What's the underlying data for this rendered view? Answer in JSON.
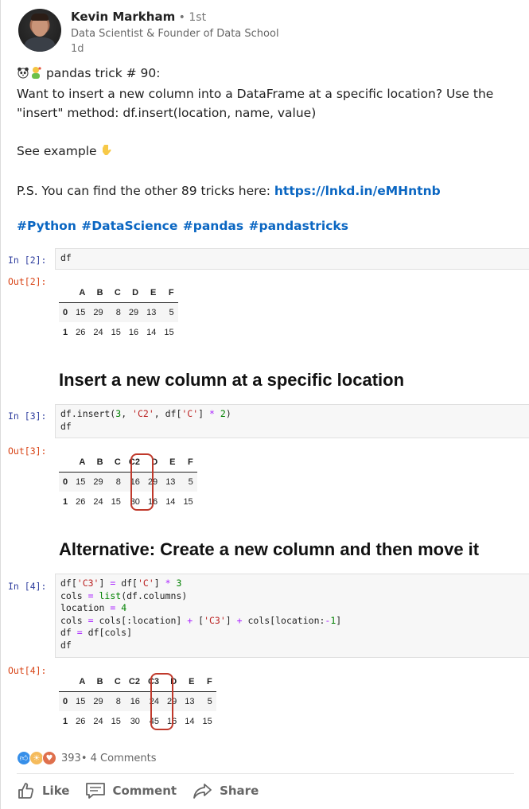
{
  "author": {
    "name": "Kevin Markham",
    "degree": " • 1st",
    "headline": "Data Scientist & Founder of Data School",
    "time": "1d"
  },
  "post": {
    "line1": "pandas trick # 90:",
    "line2": "Want to insert a new column into a DataFrame at a specific location? Use the",
    "line3": "\"insert\" method: df.insert(location, name, value)",
    "see_example": "See example",
    "ps_text": "P.S. You can find the other 89 tricks here: ",
    "ps_link": "https://lnkd.in/eMHntnb",
    "hashtags": "#Python #DataScience #pandas #pandastricks"
  },
  "notebook": {
    "in2": "In [2]:",
    "in2_code": "df",
    "out2": "Out[2]:",
    "in3": "In [3]:",
    "out3": "Out[3]:",
    "in4": "In [4]:",
    "out4": "Out[4]:",
    "title1": "Insert a new column at a specific location",
    "title2": "Alternative: Create a new column and then move it",
    "table1": {
      "columns": [
        "",
        "A",
        "B",
        "C",
        "D",
        "E",
        "F"
      ],
      "rows": [
        [
          "0",
          "15",
          "29",
          "8",
          "29",
          "13",
          "5"
        ],
        [
          "1",
          "26",
          "24",
          "15",
          "16",
          "14",
          "15"
        ]
      ]
    },
    "table2": {
      "columns": [
        "",
        "A",
        "B",
        "C",
        "C2",
        "D",
        "E",
        "F"
      ],
      "rows": [
        [
          "0",
          "15",
          "29",
          "8",
          "16",
          "29",
          "13",
          "5"
        ],
        [
          "1",
          "26",
          "24",
          "15",
          "30",
          "16",
          "14",
          "15"
        ]
      ]
    },
    "table3": {
      "columns": [
        "",
        "A",
        "B",
        "C",
        "C2",
        "C3",
        "D",
        "E",
        "F"
      ],
      "rows": [
        [
          "0",
          "15",
          "29",
          "8",
          "16",
          "24",
          "29",
          "13",
          "5"
        ],
        [
          "1",
          "26",
          "24",
          "15",
          "30",
          "45",
          "16",
          "14",
          "15"
        ]
      ]
    }
  },
  "social": {
    "reaction_count": "393",
    "comments": " • 4 Comments",
    "like": "Like",
    "comment": "Comment",
    "share": "Share",
    "colors": {
      "like": "#378fe9",
      "insightful": "#f5bb5c",
      "love": "#df704d"
    }
  }
}
